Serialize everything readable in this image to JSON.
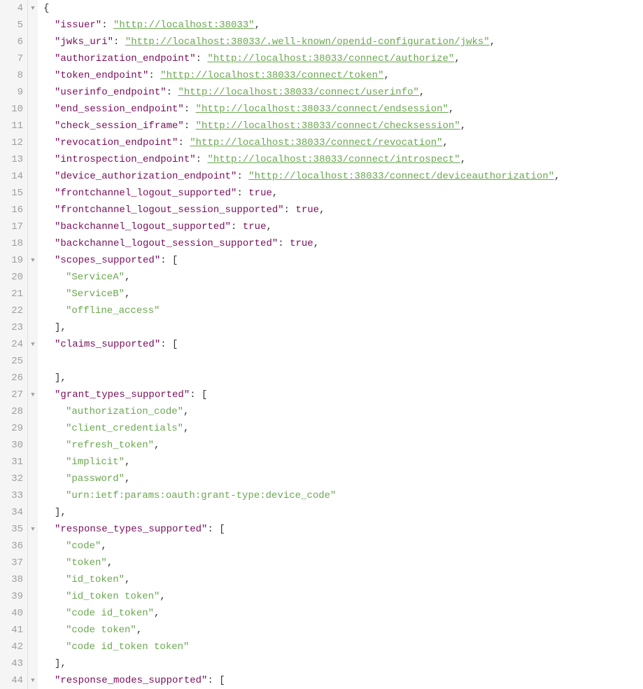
{
  "lines": [
    {
      "num": 4,
      "fold": "▼",
      "tokens": [
        {
          "t": "{",
          "c": "punc"
        }
      ]
    },
    {
      "num": 5,
      "indent": 1,
      "tokens": [
        {
          "t": "\"issuer\"",
          "c": "key"
        },
        {
          "t": ": ",
          "c": "punc"
        },
        {
          "t": "\"http://localhost:38033\"",
          "c": "link"
        },
        {
          "t": ",",
          "c": "punc"
        }
      ]
    },
    {
      "num": 6,
      "indent": 1,
      "tokens": [
        {
          "t": "\"jwks_uri\"",
          "c": "key"
        },
        {
          "t": ": ",
          "c": "punc"
        },
        {
          "t": "\"http://localhost:38033/.well-known/openid-configuration/jwks\"",
          "c": "link"
        },
        {
          "t": ",",
          "c": "punc"
        }
      ]
    },
    {
      "num": 7,
      "indent": 1,
      "tokens": [
        {
          "t": "\"authorization_endpoint\"",
          "c": "key"
        },
        {
          "t": ": ",
          "c": "punc"
        },
        {
          "t": "\"http://localhost:38033/connect/authorize\"",
          "c": "link"
        },
        {
          "t": ",",
          "c": "punc"
        }
      ]
    },
    {
      "num": 8,
      "indent": 1,
      "tokens": [
        {
          "t": "\"token_endpoint\"",
          "c": "key"
        },
        {
          "t": ": ",
          "c": "punc"
        },
        {
          "t": "\"http://localhost:38033/connect/token\"",
          "c": "link"
        },
        {
          "t": ",",
          "c": "punc"
        }
      ]
    },
    {
      "num": 9,
      "indent": 1,
      "tokens": [
        {
          "t": "\"userinfo_endpoint\"",
          "c": "key"
        },
        {
          "t": ": ",
          "c": "punc"
        },
        {
          "t": "\"http://localhost:38033/connect/userinfo\"",
          "c": "link"
        },
        {
          "t": ",",
          "c": "punc"
        }
      ]
    },
    {
      "num": 10,
      "indent": 1,
      "tokens": [
        {
          "t": "\"end_session_endpoint\"",
          "c": "key"
        },
        {
          "t": ": ",
          "c": "punc"
        },
        {
          "t": "\"http://localhost:38033/connect/endsession\"",
          "c": "link"
        },
        {
          "t": ",",
          "c": "punc"
        }
      ]
    },
    {
      "num": 11,
      "indent": 1,
      "tokens": [
        {
          "t": "\"check_session_iframe\"",
          "c": "key"
        },
        {
          "t": ": ",
          "c": "punc"
        },
        {
          "t": "\"http://localhost:38033/connect/checksession\"",
          "c": "link"
        },
        {
          "t": ",",
          "c": "punc"
        }
      ]
    },
    {
      "num": 12,
      "indent": 1,
      "tokens": [
        {
          "t": "\"revocation_endpoint\"",
          "c": "key"
        },
        {
          "t": ": ",
          "c": "punc"
        },
        {
          "t": "\"http://localhost:38033/connect/revocation\"",
          "c": "link"
        },
        {
          "t": ",",
          "c": "punc"
        }
      ]
    },
    {
      "num": 13,
      "indent": 1,
      "tokens": [
        {
          "t": "\"introspection_endpoint\"",
          "c": "key"
        },
        {
          "t": ": ",
          "c": "punc"
        },
        {
          "t": "\"http://localhost:38033/connect/introspect\"",
          "c": "link"
        },
        {
          "t": ",",
          "c": "punc"
        }
      ]
    },
    {
      "num": 14,
      "indent": 1,
      "tokens": [
        {
          "t": "\"device_authorization_endpoint\"",
          "c": "key"
        },
        {
          "t": ": ",
          "c": "punc"
        },
        {
          "t": "\"http://localhost:38033/connect/deviceauthorization\"",
          "c": "link"
        },
        {
          "t": ",",
          "c": "punc"
        }
      ]
    },
    {
      "num": 15,
      "indent": 1,
      "tokens": [
        {
          "t": "\"frontchannel_logout_supported\"",
          "c": "key"
        },
        {
          "t": ": ",
          "c": "punc"
        },
        {
          "t": "true",
          "c": "kw"
        },
        {
          "t": ",",
          "c": "punc"
        }
      ]
    },
    {
      "num": 16,
      "indent": 1,
      "tokens": [
        {
          "t": "\"frontchannel_logout_session_supported\"",
          "c": "key"
        },
        {
          "t": ": ",
          "c": "punc"
        },
        {
          "t": "true",
          "c": "kw"
        },
        {
          "t": ",",
          "c": "punc"
        }
      ]
    },
    {
      "num": 17,
      "indent": 1,
      "tokens": [
        {
          "t": "\"backchannel_logout_supported\"",
          "c": "key"
        },
        {
          "t": ": ",
          "c": "punc"
        },
        {
          "t": "true",
          "c": "kw"
        },
        {
          "t": ",",
          "c": "punc"
        }
      ]
    },
    {
      "num": 18,
      "indent": 1,
      "tokens": [
        {
          "t": "\"backchannel_logout_session_supported\"",
          "c": "key"
        },
        {
          "t": ": ",
          "c": "punc"
        },
        {
          "t": "true",
          "c": "kw"
        },
        {
          "t": ",",
          "c": "punc"
        }
      ]
    },
    {
      "num": 19,
      "fold": "▼",
      "indent": 1,
      "tokens": [
        {
          "t": "\"scopes_supported\"",
          "c": "key"
        },
        {
          "t": ": [",
          "c": "punc"
        }
      ]
    },
    {
      "num": 20,
      "indent": 2,
      "tokens": [
        {
          "t": "\"ServiceA\"",
          "c": "str"
        },
        {
          "t": ",",
          "c": "punc"
        }
      ]
    },
    {
      "num": 21,
      "indent": 2,
      "tokens": [
        {
          "t": "\"ServiceB\"",
          "c": "str"
        },
        {
          "t": ",",
          "c": "punc"
        }
      ]
    },
    {
      "num": 22,
      "indent": 2,
      "tokens": [
        {
          "t": "\"offline_access\"",
          "c": "str"
        }
      ]
    },
    {
      "num": 23,
      "indent": 1,
      "tokens": [
        {
          "t": "],",
          "c": "punc"
        }
      ]
    },
    {
      "num": 24,
      "fold": "▼",
      "indent": 1,
      "tokens": [
        {
          "t": "\"claims_supported\"",
          "c": "key"
        },
        {
          "t": ": [",
          "c": "punc"
        }
      ]
    },
    {
      "num": 25,
      "indent": 1,
      "tokens": []
    },
    {
      "num": 26,
      "indent": 1,
      "tokens": [
        {
          "t": "],",
          "c": "punc"
        }
      ]
    },
    {
      "num": 27,
      "fold": "▼",
      "indent": 1,
      "tokens": [
        {
          "t": "\"grant_types_supported\"",
          "c": "key"
        },
        {
          "t": ": [",
          "c": "punc"
        }
      ]
    },
    {
      "num": 28,
      "indent": 2,
      "tokens": [
        {
          "t": "\"authorization_code\"",
          "c": "str"
        },
        {
          "t": ",",
          "c": "punc"
        }
      ]
    },
    {
      "num": 29,
      "indent": 2,
      "tokens": [
        {
          "t": "\"client_credentials\"",
          "c": "str"
        },
        {
          "t": ",",
          "c": "punc"
        }
      ]
    },
    {
      "num": 30,
      "indent": 2,
      "tokens": [
        {
          "t": "\"refresh_token\"",
          "c": "str"
        },
        {
          "t": ",",
          "c": "punc"
        }
      ]
    },
    {
      "num": 31,
      "indent": 2,
      "tokens": [
        {
          "t": "\"implicit\"",
          "c": "str"
        },
        {
          "t": ",",
          "c": "punc"
        }
      ]
    },
    {
      "num": 32,
      "indent": 2,
      "tokens": [
        {
          "t": "\"password\"",
          "c": "str"
        },
        {
          "t": ",",
          "c": "punc"
        }
      ]
    },
    {
      "num": 33,
      "indent": 2,
      "tokens": [
        {
          "t": "\"urn:ietf:params:oauth:grant-type:device_code\"",
          "c": "str"
        }
      ]
    },
    {
      "num": 34,
      "indent": 1,
      "tokens": [
        {
          "t": "],",
          "c": "punc"
        }
      ]
    },
    {
      "num": 35,
      "fold": "▼",
      "indent": 1,
      "tokens": [
        {
          "t": "\"response_types_supported\"",
          "c": "key"
        },
        {
          "t": ": [",
          "c": "punc"
        }
      ]
    },
    {
      "num": 36,
      "indent": 2,
      "tokens": [
        {
          "t": "\"code\"",
          "c": "str"
        },
        {
          "t": ",",
          "c": "punc"
        }
      ]
    },
    {
      "num": 37,
      "indent": 2,
      "tokens": [
        {
          "t": "\"token\"",
          "c": "str"
        },
        {
          "t": ",",
          "c": "punc"
        }
      ]
    },
    {
      "num": 38,
      "indent": 2,
      "tokens": [
        {
          "t": "\"id_token\"",
          "c": "str"
        },
        {
          "t": ",",
          "c": "punc"
        }
      ]
    },
    {
      "num": 39,
      "indent": 2,
      "tokens": [
        {
          "t": "\"id_token token\"",
          "c": "str"
        },
        {
          "t": ",",
          "c": "punc"
        }
      ]
    },
    {
      "num": 40,
      "indent": 2,
      "tokens": [
        {
          "t": "\"code id_token\"",
          "c": "str"
        },
        {
          "t": ",",
          "c": "punc"
        }
      ]
    },
    {
      "num": 41,
      "indent": 2,
      "tokens": [
        {
          "t": "\"code token\"",
          "c": "str"
        },
        {
          "t": ",",
          "c": "punc"
        }
      ]
    },
    {
      "num": 42,
      "indent": 2,
      "tokens": [
        {
          "t": "\"code id_token token\"",
          "c": "str"
        }
      ]
    },
    {
      "num": 43,
      "indent": 1,
      "tokens": [
        {
          "t": "],",
          "c": "punc"
        }
      ]
    },
    {
      "num": 44,
      "fold": "▼",
      "indent": 1,
      "tokens": [
        {
          "t": "\"response_modes_supported\"",
          "c": "key"
        },
        {
          "t": ": [",
          "c": "punc"
        }
      ]
    }
  ]
}
